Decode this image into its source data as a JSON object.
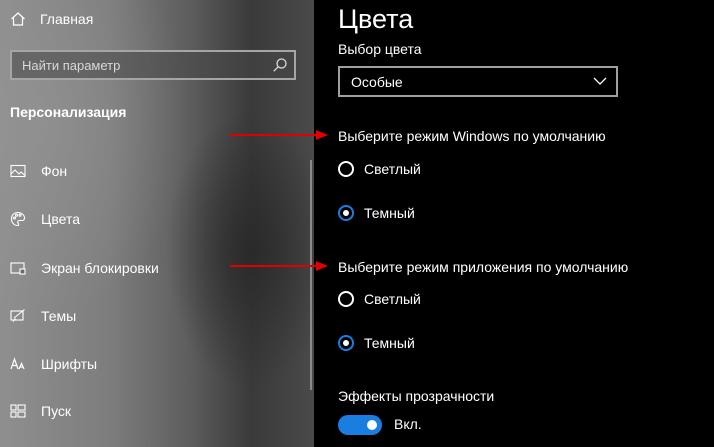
{
  "sidebar": {
    "home_label": "Главная",
    "search_placeholder": "Найти параметр",
    "section_title": "Персонализация",
    "items": [
      {
        "label": "Фон",
        "icon": "picture-icon"
      },
      {
        "label": "Цвета",
        "icon": "palette-icon"
      },
      {
        "label": "Экран блокировки",
        "icon": "lock-screen-icon"
      },
      {
        "label": "Темы",
        "icon": "themes-icon"
      },
      {
        "label": "Шрифты",
        "icon": "fonts-icon"
      },
      {
        "label": "Пуск",
        "icon": "start-icon"
      }
    ]
  },
  "main": {
    "title": "Цвета",
    "color_choice_label": "Выбор цвета",
    "color_choice_value": "Особые",
    "windows_mode": {
      "title": "Выберите режим Windows по умолчанию",
      "options": [
        "Светлый",
        "Темный"
      ],
      "selected": "Темный"
    },
    "app_mode": {
      "title": "Выберите режим приложения по умолчанию",
      "options": [
        "Светлый",
        "Темный"
      ],
      "selected": "Темный"
    },
    "transparency": {
      "label": "Эффекты прозрачности",
      "state": "Вкл.",
      "on": true
    }
  },
  "colors": {
    "accent": "#1a7ee0",
    "annotation_arrow": "#e00000",
    "main_bg": "#000000"
  }
}
